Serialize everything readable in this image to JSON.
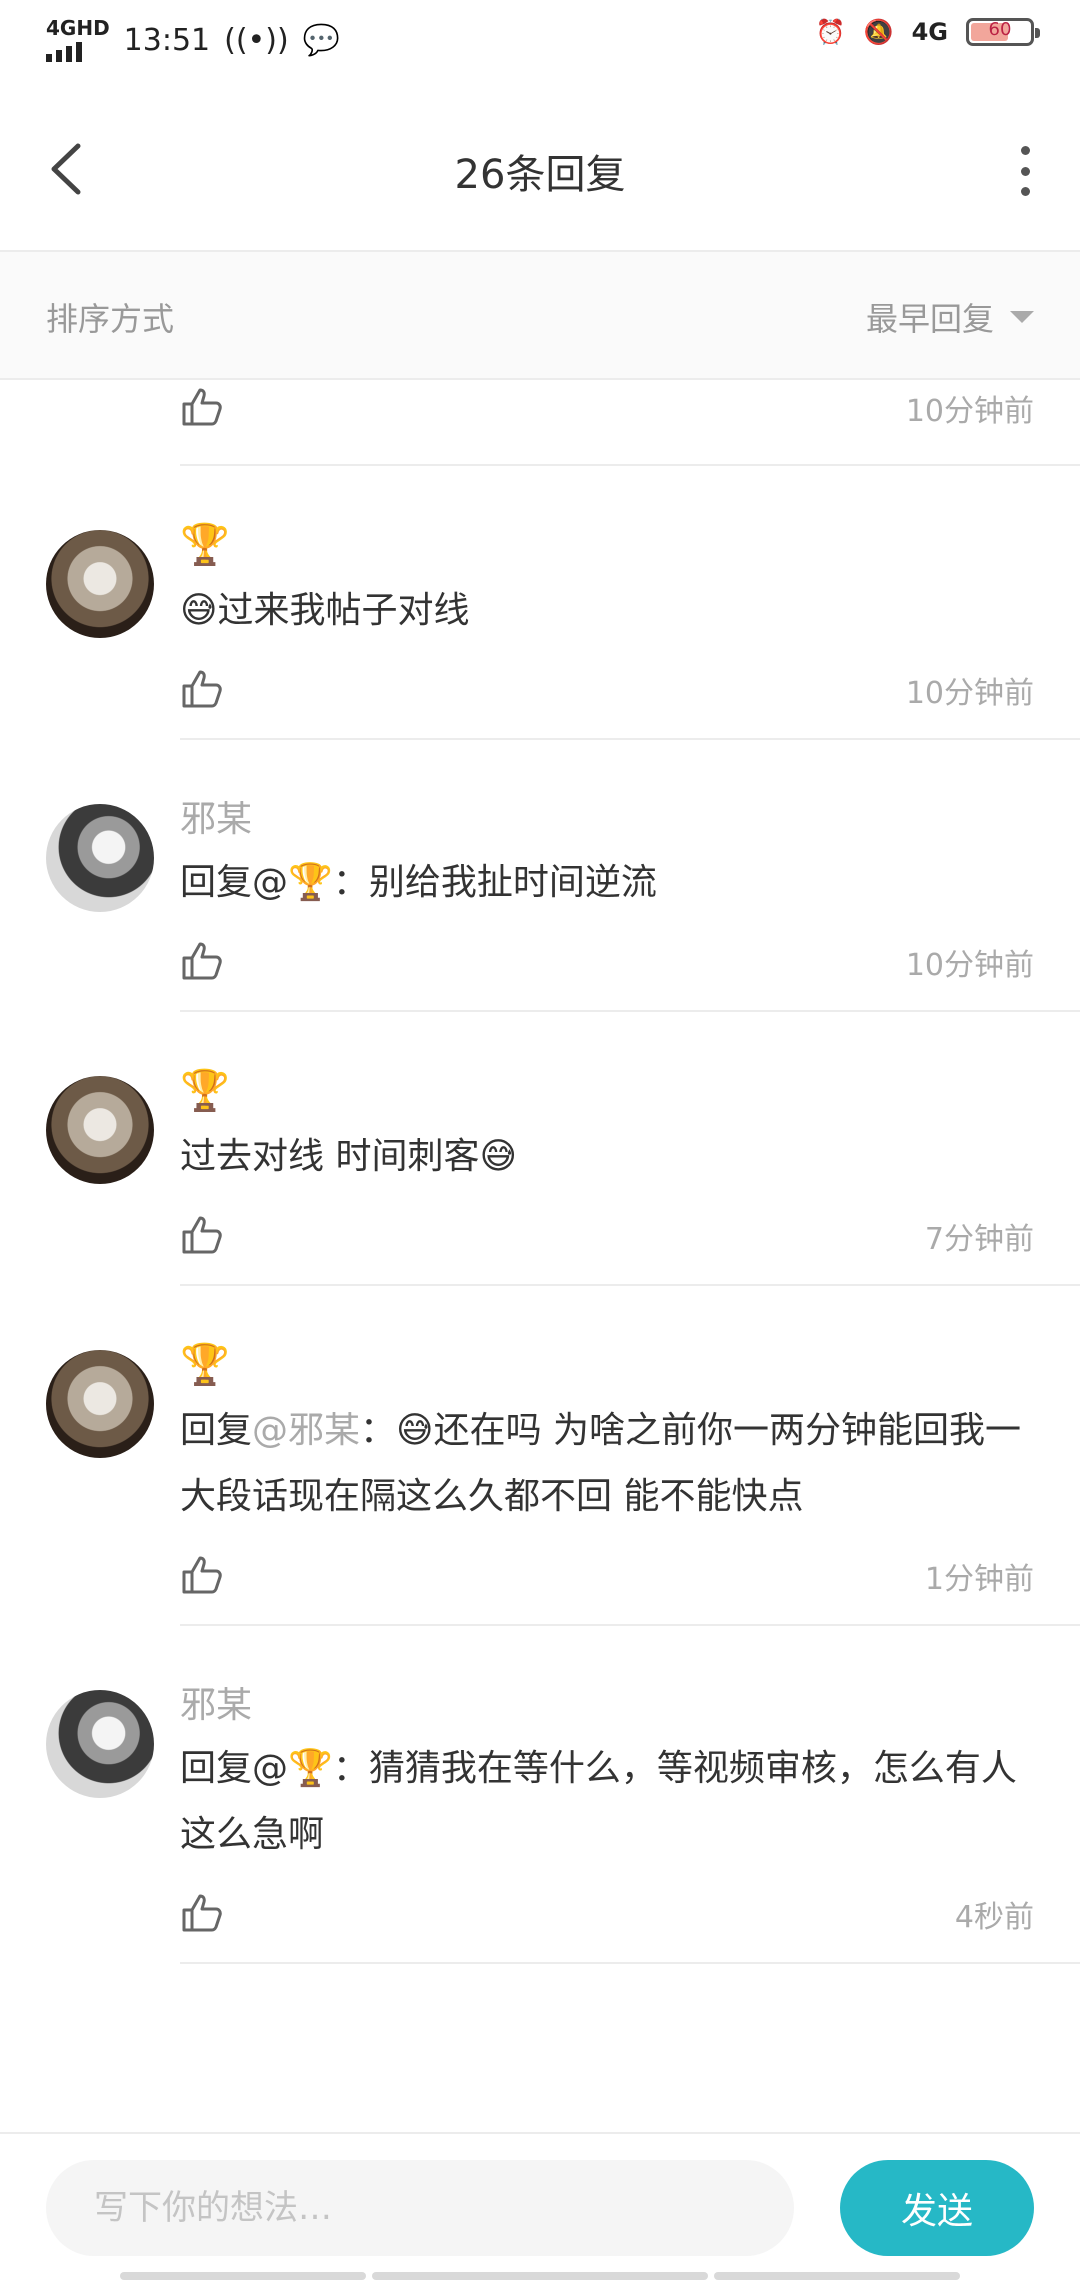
{
  "status_bar": {
    "network": "4GHD",
    "time": "13:51",
    "network_right": "4G",
    "battery": "60",
    "battery_level": 0.6,
    "icons": [
      "signal-icon",
      "hotspot-icon",
      "wechat-icon",
      "alarm-icon",
      "mute-icon",
      "battery-icon"
    ]
  },
  "header": {
    "title": "26条回复",
    "back_icon": "chevron-left-icon",
    "more_icon": "more-vertical-icon"
  },
  "sort": {
    "label": "排序方式",
    "selected": "最早回复"
  },
  "partial_row": {
    "time": "10分钟前"
  },
  "comments": [
    {
      "user": "🏆",
      "text": "😅过来我帖子对线",
      "time": "10分钟前"
    },
    {
      "user": "邪某",
      "prefix": "回复@🏆：",
      "text": "别给我扯时间逆流",
      "time": "10分钟前"
    },
    {
      "user": "🏆",
      "text": "过去对线 时间刺客😅",
      "time": "7分钟前"
    },
    {
      "user": "🏆",
      "prefix": "回复",
      "mention": "@邪某",
      "colon": "：",
      "text": "😅还在吗 为啥之前你一两分钟能回我一大段话现在隔这么久都不回 能不能快点",
      "time": "1分钟前"
    },
    {
      "user": "邪某",
      "prefix": "回复@🏆：",
      "text": "猜猜我在等什么，等视频审核，怎么有人这么急啊",
      "time": "4秒前"
    }
  ],
  "composer": {
    "placeholder": "写下你的想法…",
    "send_label": "发送"
  },
  "colors": {
    "accent": "#26b8c6",
    "muted": "#aaaaaa"
  }
}
